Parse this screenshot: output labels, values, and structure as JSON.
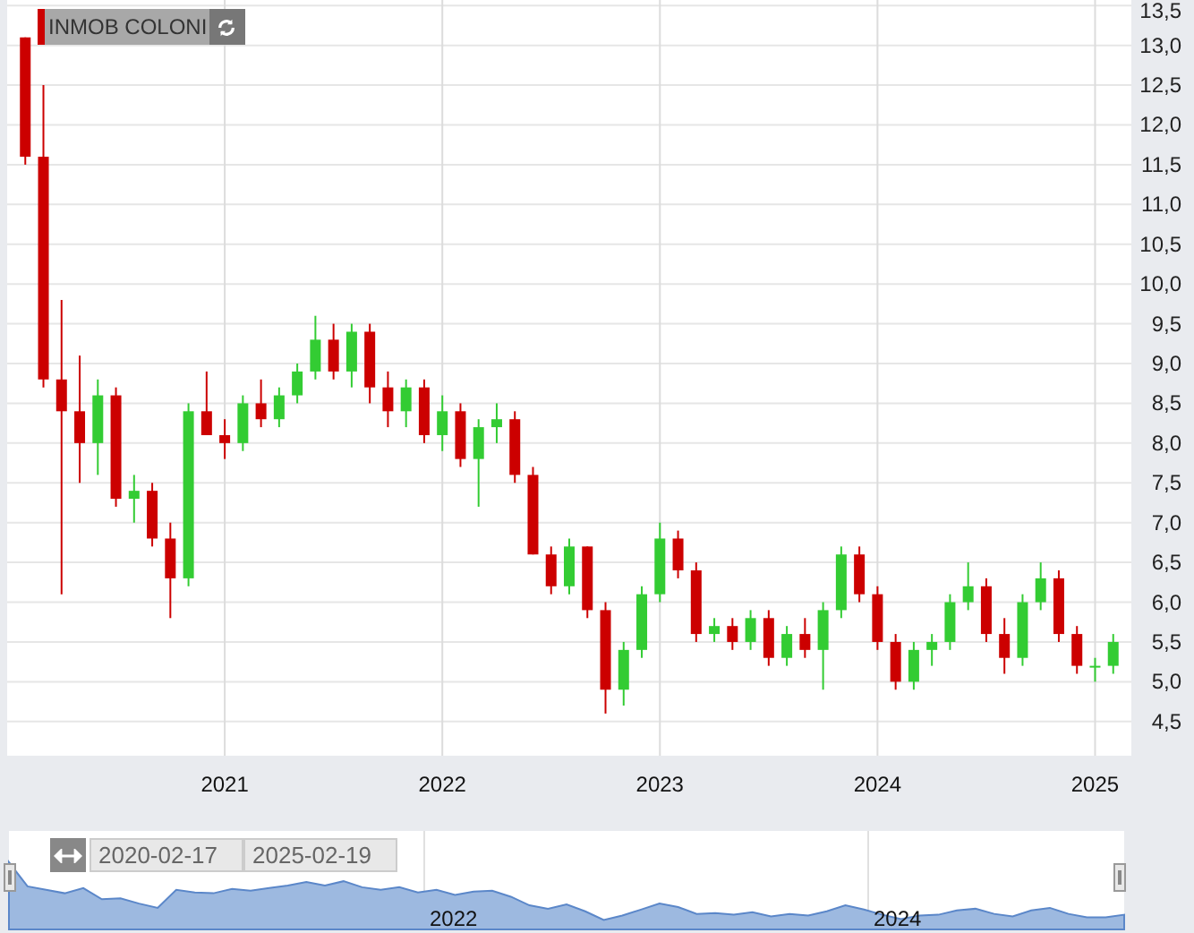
{
  "instrument_label": {
    "text": "INMOB COLONI"
  },
  "chart": {
    "chart_data": {
      "type": "candlestick",
      "grid": true,
      "x": [
        "2020-02",
        "2020-03",
        "2020-04",
        "2020-05",
        "2020-06",
        "2020-07",
        "2020-08",
        "2020-09",
        "2020-10",
        "2020-11",
        "2020-12",
        "2021-01",
        "2021-02",
        "2021-03",
        "2021-04",
        "2021-05",
        "2021-06",
        "2021-07",
        "2021-08",
        "2021-09",
        "2021-10",
        "2021-11",
        "2021-12",
        "2022-01",
        "2022-02",
        "2022-03",
        "2022-04",
        "2022-05",
        "2022-06",
        "2022-07",
        "2022-08",
        "2022-09",
        "2022-10",
        "2022-11",
        "2022-12",
        "2023-01",
        "2023-02",
        "2023-03",
        "2023-04",
        "2023-05",
        "2023-06",
        "2023-07",
        "2023-08",
        "2023-09",
        "2023-10",
        "2023-11",
        "2023-12",
        "2024-01",
        "2024-02",
        "2024-03",
        "2024-04",
        "2024-05",
        "2024-06",
        "2024-07",
        "2024-08",
        "2024-09",
        "2024-10",
        "2024-11",
        "2024-12",
        "2025-01",
        "2025-02"
      ],
      "ohlc": [
        [
          13.1,
          13.1,
          11.5,
          11.6
        ],
        [
          11.6,
          12.5,
          8.7,
          8.8
        ],
        [
          8.8,
          9.8,
          6.1,
          8.4
        ],
        [
          8.4,
          9.1,
          7.5,
          8.0
        ],
        [
          8.0,
          8.8,
          7.6,
          8.6
        ],
        [
          8.6,
          8.7,
          7.2,
          7.3
        ],
        [
          7.3,
          7.6,
          7.0,
          7.4
        ],
        [
          7.4,
          7.5,
          6.7,
          6.8
        ],
        [
          6.8,
          7.0,
          5.8,
          6.3
        ],
        [
          6.3,
          8.5,
          6.2,
          8.4
        ],
        [
          8.4,
          8.9,
          8.1,
          8.1
        ],
        [
          8.1,
          8.3,
          7.8,
          8.0
        ],
        [
          8.0,
          8.6,
          7.9,
          8.5
        ],
        [
          8.5,
          8.8,
          8.2,
          8.3
        ],
        [
          8.3,
          8.7,
          8.2,
          8.6
        ],
        [
          8.6,
          9.0,
          8.5,
          8.9
        ],
        [
          8.9,
          9.6,
          8.8,
          9.3
        ],
        [
          9.3,
          9.5,
          8.8,
          8.9
        ],
        [
          8.9,
          9.5,
          8.7,
          9.4
        ],
        [
          9.4,
          9.5,
          8.5,
          8.7
        ],
        [
          8.7,
          8.9,
          8.2,
          8.4
        ],
        [
          8.4,
          8.8,
          8.2,
          8.7
        ],
        [
          8.7,
          8.8,
          8.0,
          8.1
        ],
        [
          8.1,
          8.6,
          7.9,
          8.4
        ],
        [
          8.4,
          8.5,
          7.7,
          7.8
        ],
        [
          7.8,
          8.3,
          7.2,
          8.2
        ],
        [
          8.2,
          8.5,
          8.0,
          8.3
        ],
        [
          8.3,
          8.4,
          7.5,
          7.6
        ],
        [
          7.6,
          7.7,
          6.6,
          6.6
        ],
        [
          6.6,
          6.7,
          6.1,
          6.2
        ],
        [
          6.2,
          6.8,
          6.1,
          6.7
        ],
        [
          6.7,
          6.7,
          5.8,
          5.9
        ],
        [
          5.9,
          6.0,
          4.6,
          4.9
        ],
        [
          4.9,
          5.5,
          4.7,
          5.4
        ],
        [
          5.4,
          6.2,
          5.3,
          6.1
        ],
        [
          6.1,
          7.0,
          6.0,
          6.8
        ],
        [
          6.8,
          6.9,
          6.3,
          6.4
        ],
        [
          6.4,
          6.5,
          5.5,
          5.6
        ],
        [
          5.6,
          5.8,
          5.5,
          5.7
        ],
        [
          5.7,
          5.8,
          5.4,
          5.5
        ],
        [
          5.5,
          5.9,
          5.4,
          5.8
        ],
        [
          5.8,
          5.9,
          5.2,
          5.3
        ],
        [
          5.3,
          5.7,
          5.2,
          5.6
        ],
        [
          5.6,
          5.8,
          5.3,
          5.4
        ],
        [
          5.4,
          6.0,
          4.9,
          5.9
        ],
        [
          5.9,
          6.7,
          5.8,
          6.6
        ],
        [
          6.6,
          6.7,
          6.0,
          6.1
        ],
        [
          6.1,
          6.2,
          5.4,
          5.5
        ],
        [
          5.5,
          5.6,
          4.9,
          5.0
        ],
        [
          5.0,
          5.5,
          4.9,
          5.4
        ],
        [
          5.4,
          5.6,
          5.2,
          5.5
        ],
        [
          5.5,
          6.1,
          5.4,
          6.0
        ],
        [
          6.0,
          6.5,
          5.9,
          6.2
        ],
        [
          6.2,
          6.3,
          5.5,
          5.6
        ],
        [
          5.6,
          5.8,
          5.1,
          5.3
        ],
        [
          5.3,
          6.1,
          5.2,
          6.0
        ],
        [
          6.0,
          6.5,
          5.9,
          6.3
        ],
        [
          6.3,
          6.4,
          5.5,
          5.6
        ],
        [
          5.6,
          5.7,
          5.1,
          5.2
        ],
        [
          5.2,
          5.3,
          5.0,
          5.2
        ],
        [
          5.2,
          5.6,
          5.1,
          5.5
        ]
      ],
      "xlim": [
        "2020-01",
        "2025-03"
      ],
      "ylim": [
        4.07,
        13.57
      ],
      "yticks": [
        {
          "value": 4.5,
          "label": "4,5"
        },
        {
          "value": 5,
          "label": "5,0"
        },
        {
          "value": 5.5,
          "label": "5,5"
        },
        {
          "value": 6,
          "label": "6,0"
        },
        {
          "value": 6.5,
          "label": "6,5"
        },
        {
          "value": 7,
          "label": "7,0"
        },
        {
          "value": 7.5,
          "label": "7,5"
        },
        {
          "value": 8,
          "label": "8,0"
        },
        {
          "value": 8.5,
          "label": "8,5"
        },
        {
          "value": 9,
          "label": "9,0"
        },
        {
          "value": 9.5,
          "label": "9,5"
        },
        {
          "value": 10,
          "label": "10,0"
        },
        {
          "value": 10.5,
          "label": "10,5"
        },
        {
          "value": 11,
          "label": "11,0"
        },
        {
          "value": 11.5,
          "label": "11,5"
        },
        {
          "value": 12,
          "label": "12,0"
        },
        {
          "value": 12.5,
          "label": "12,5"
        },
        {
          "value": 13,
          "label": "13,0"
        },
        {
          "value": 13.5,
          "label": "13,5"
        }
      ],
      "xticks": [
        {
          "value": "2021-01",
          "label": "2021"
        },
        {
          "value": "2022-01",
          "label": "2022"
        },
        {
          "value": "2023-01",
          "label": "2023"
        },
        {
          "value": "2024-01",
          "label": "2024"
        },
        {
          "value": "2025-01",
          "label": "2025"
        }
      ]
    }
  },
  "navigator": {
    "from_date": "2020-02-17",
    "to_date": "2025-02-19",
    "year_labels": [
      "2022",
      "2024"
    ]
  }
}
